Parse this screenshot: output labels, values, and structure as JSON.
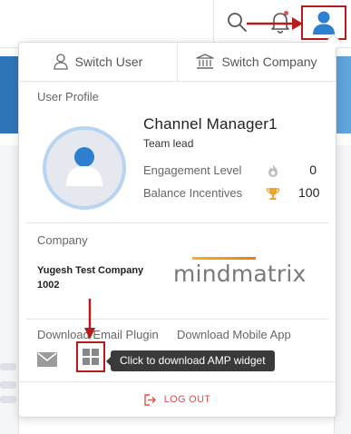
{
  "header": {
    "search_icon": "search-icon",
    "bell_icon": "bell-icon",
    "user_icon": "user-icon"
  },
  "dropdown": {
    "switch_user_label": "Switch User",
    "switch_company_label": "Switch Company",
    "user_profile_heading": "User Profile",
    "user_name": "Channel Manager1",
    "user_role": "Team lead",
    "stats": [
      {
        "label": "Engagement Level",
        "value": "0",
        "icon": "engagement-icon"
      },
      {
        "label": "Balance Incentives",
        "value": "100",
        "icon": "trophy-icon"
      }
    ],
    "company_heading": "Company",
    "company_name": "Yugesh Test Company 1002",
    "company_logo_text": "mindmatrix",
    "download_email_plugin": "Download Email Plugin",
    "download_mobile_app": "Download Mobile App",
    "tooltip": "Click to download AMP widget",
    "logout_label": "LOG OUT"
  },
  "colors": {
    "accent_blue": "#2f7fd0",
    "highlight_red": "#b71c1c",
    "logout_red": "#d9534f",
    "trophy_orange": "#f0a12a"
  }
}
